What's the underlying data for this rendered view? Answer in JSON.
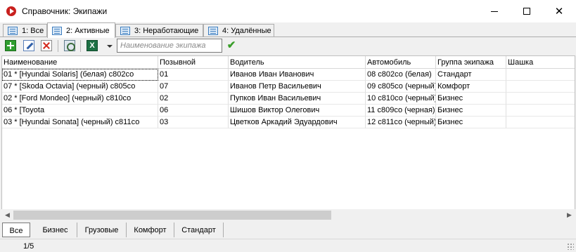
{
  "window": {
    "title": "Справочник: Экипажи",
    "icon": "record-icon",
    "controls": [
      "minimize",
      "maximize",
      "close"
    ]
  },
  "tabs": [
    {
      "label": "1: Все",
      "active": false
    },
    {
      "label": "2: Активные",
      "active": true
    },
    {
      "label": "3: Неработающие",
      "active": false
    },
    {
      "label": "4: Удалённые",
      "active": false
    }
  ],
  "toolbar": {
    "buttons": [
      "add-icon",
      "edit-icon",
      "delete-icon",
      "properties-icon",
      "excel-icon",
      "dropdown-arrow-icon"
    ],
    "search_placeholder": "Наименование экипажа",
    "search_value": "",
    "apply_icon": "checkmark-icon"
  },
  "table": {
    "columns": [
      "Наименование",
      "Позывной",
      "Водитель",
      "Автомобиль",
      "Группа экипажа",
      "Шашка"
    ],
    "rows": [
      [
        "01 * [Hyundai Solaris] (белая) с802со",
        "01",
        "Иванов Иван Иванович",
        "08 с802со (белая)",
        "Стандарт",
        ""
      ],
      [
        "07 * [Skoda Octavia] (черный) с805со",
        "07",
        "Иванов Петр Васильевич",
        "09 с805со (черный)",
        "Комфорт",
        ""
      ],
      [
        "02 * [Ford Mondeo] (черный) с810со",
        "02",
        "Пупков Иван Васильевич",
        "10 с810со (черный)",
        "Бизнес",
        ""
      ],
      [
        "06 * [Toyota",
        "06",
        "Шишов Виктор Олегович",
        "11 с809со (черная)",
        "Бизнес",
        ""
      ],
      [
        "03 * [Hyundai Sonata] (черный) с811со",
        "03",
        "Цветков Аркадий Эдуардович",
        "12 с811со (черный)",
        "Бизнес",
        ""
      ]
    ]
  },
  "bottom_tabs": [
    {
      "label": "Все",
      "active": true
    },
    {
      "label": "Бизнес",
      "active": false
    },
    {
      "label": "Грузовые",
      "active": false
    },
    {
      "label": "Комфорт",
      "active": false
    },
    {
      "label": "Стандарт",
      "active": false
    }
  ],
  "status": {
    "record_counter": "1/5"
  },
  "colors": {
    "accent": "#3d7ebf",
    "window_bg": "#f0f0f0",
    "grid_bg": "#ffffff"
  }
}
